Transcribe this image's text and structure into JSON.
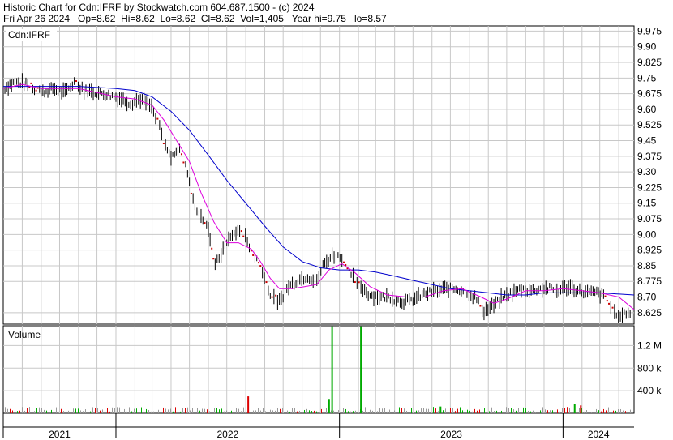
{
  "header": {
    "line1": "Historic Chart for Cdn:IFRF by Stockwatch.com 604.687.1500 - (c) 2024",
    "line2": "Fri Apr 26 2024   Op=8.62  Hi=8.62  Lo=8.62  Cl=8.62  Vol=1,405   Year hi=9.75   lo=8.57"
  },
  "colors": {
    "price_bar": "#000000",
    "down_dot": "#cc0000",
    "ma_short": "#dd00dd",
    "ma_long": "#0000cc",
    "volume_up": "#00aa00",
    "volume_down": "#dd0000",
    "volume_neutral": "#999999",
    "grid": "#c8c8c8"
  },
  "chart_data": {
    "type": "line",
    "symbol_label": "Cdn:IFRF",
    "volume_title": "Volume",
    "x_range": [
      "2021-07-01",
      "2024-04-26"
    ],
    "ylim": [
      8.57,
      10.0
    ],
    "price_ticks": [
      "9.975",
      "9.90",
      "9.825",
      "9.75",
      "9.675",
      "9.60",
      "9.525",
      "9.45",
      "9.375",
      "9.30",
      "9.225",
      "9.15",
      "9.075",
      "9.00",
      "8.925",
      "8.85",
      "8.775",
      "8.70",
      "8.625"
    ],
    "volume_ticks": [
      {
        "label": "1.2 M",
        "value": 1200000
      },
      {
        "label": "800 k",
        "value": 800000
      },
      {
        "label": "400 k",
        "value": 400000
      }
    ],
    "volume_ylim": [
      0,
      1550000
    ],
    "years": [
      {
        "label": "2021",
        "start": "2021-07-01",
        "end": "2022-01-01"
      },
      {
        "label": "2022",
        "start": "2022-01-01",
        "end": "2023-01-01"
      },
      {
        "label": "2023",
        "start": "2023-01-01",
        "end": "2024-01-01"
      },
      {
        "label": "2024",
        "start": "2024-01-01",
        "end": "2024-04-26"
      }
    ],
    "close": [
      [
        "2021-07-01",
        9.7
      ],
      [
        "2021-07-20",
        9.73
      ],
      [
        "2021-08-10",
        9.72
      ],
      [
        "2021-09-01",
        9.68
      ],
      [
        "2021-09-20",
        9.7
      ],
      [
        "2021-10-10",
        9.68
      ],
      [
        "2021-10-25",
        9.73
      ],
      [
        "2021-11-10",
        9.69
      ],
      [
        "2021-12-01",
        9.68
      ],
      [
        "2021-12-20",
        9.67
      ],
      [
        "2022-01-10",
        9.65
      ],
      [
        "2022-01-25",
        9.63
      ],
      [
        "2022-02-10",
        9.65
      ],
      [
        "2022-02-25",
        9.62
      ],
      [
        "2022-03-10",
        9.55
      ],
      [
        "2022-03-20",
        9.45
      ],
      [
        "2022-04-01",
        9.38
      ],
      [
        "2022-04-15",
        9.4
      ],
      [
        "2022-04-28",
        9.3
      ],
      [
        "2022-05-10",
        9.12
      ],
      [
        "2022-05-20",
        9.1
      ],
      [
        "2022-06-01",
        9.02
      ],
      [
        "2022-06-12",
        8.85
      ],
      [
        "2022-06-25",
        8.93
      ],
      [
        "2022-07-10",
        9.0
      ],
      [
        "2022-07-25",
        9.02
      ],
      [
        "2022-08-10",
        8.93
      ],
      [
        "2022-08-25",
        8.85
      ],
      [
        "2022-09-10",
        8.72
      ],
      [
        "2022-09-25",
        8.68
      ],
      [
        "2022-10-10",
        8.75
      ],
      [
        "2022-10-25",
        8.78
      ],
      [
        "2022-11-10",
        8.8
      ],
      [
        "2022-11-25",
        8.77
      ],
      [
        "2022-12-05",
        8.85
      ],
      [
        "2022-12-20",
        8.9
      ],
      [
        "2023-01-05",
        8.89
      ],
      [
        "2023-01-20",
        8.8
      ],
      [
        "2023-02-05",
        8.75
      ],
      [
        "2023-02-20",
        8.71
      ],
      [
        "2023-03-10",
        8.7
      ],
      [
        "2023-03-25",
        8.7
      ],
      [
        "2023-04-10",
        8.68
      ],
      [
        "2023-04-25",
        8.68
      ],
      [
        "2023-05-10",
        8.7
      ],
      [
        "2023-05-25",
        8.72
      ],
      [
        "2023-06-10",
        8.73
      ],
      [
        "2023-06-25",
        8.74
      ],
      [
        "2023-07-10",
        8.74
      ],
      [
        "2023-07-25",
        8.73
      ],
      [
        "2023-08-10",
        8.7
      ],
      [
        "2023-08-25",
        8.63
      ],
      [
        "2023-09-10",
        8.66
      ],
      [
        "2023-09-25",
        8.7
      ],
      [
        "2023-10-10",
        8.72
      ],
      [
        "2023-10-25",
        8.74
      ],
      [
        "2023-11-10",
        8.73
      ],
      [
        "2023-11-25",
        8.74
      ],
      [
        "2023-12-10",
        8.74
      ],
      [
        "2023-12-25",
        8.73
      ],
      [
        "2024-01-10",
        8.75
      ],
      [
        "2024-01-25",
        8.73
      ],
      [
        "2024-02-10",
        8.72
      ],
      [
        "2024-02-25",
        8.72
      ],
      [
        "2024-03-10",
        8.7
      ],
      [
        "2024-03-25",
        8.62
      ],
      [
        "2024-04-10",
        8.62
      ],
      [
        "2024-04-26",
        8.62
      ]
    ],
    "ma_short": [
      [
        "2021-07-01",
        9.7
      ],
      [
        "2021-08-01",
        9.72
      ],
      [
        "2021-09-01",
        9.7
      ],
      [
        "2021-10-01",
        9.7
      ],
      [
        "2021-11-01",
        9.7
      ],
      [
        "2021-12-01",
        9.68
      ],
      [
        "2022-01-01",
        9.66
      ],
      [
        "2022-02-01",
        9.65
      ],
      [
        "2022-03-01",
        9.62
      ],
      [
        "2022-03-20",
        9.55
      ],
      [
        "2022-04-10",
        9.45
      ],
      [
        "2022-05-01",
        9.35
      ],
      [
        "2022-05-20",
        9.2
      ],
      [
        "2022-06-10",
        9.06
      ],
      [
        "2022-07-01",
        8.96
      ],
      [
        "2022-07-20",
        8.96
      ],
      [
        "2022-08-10",
        8.93
      ],
      [
        "2022-08-25",
        8.87
      ],
      [
        "2022-09-10",
        8.79
      ],
      [
        "2022-09-25",
        8.74
      ],
      [
        "2022-10-15",
        8.74
      ],
      [
        "2022-11-05",
        8.75
      ],
      [
        "2022-11-25",
        8.76
      ],
      [
        "2022-12-15",
        8.83
      ],
      [
        "2023-01-05",
        8.86
      ],
      [
        "2023-01-25",
        8.82
      ],
      [
        "2023-02-20",
        8.75
      ],
      [
        "2023-03-20",
        8.71
      ],
      [
        "2023-04-20",
        8.7
      ],
      [
        "2023-05-20",
        8.7
      ],
      [
        "2023-06-20",
        8.73
      ],
      [
        "2023-07-20",
        8.74
      ],
      [
        "2023-08-20",
        8.7
      ],
      [
        "2023-09-10",
        8.67
      ],
      [
        "2023-10-01",
        8.69
      ],
      [
        "2023-11-01",
        8.73
      ],
      [
        "2023-12-01",
        8.73
      ],
      [
        "2024-01-01",
        8.74
      ],
      [
        "2024-02-01",
        8.73
      ],
      [
        "2024-03-01",
        8.72
      ],
      [
        "2024-04-01",
        8.7
      ],
      [
        "2024-04-26",
        8.64
      ]
    ],
    "ma_long": [
      [
        "2021-07-01",
        9.71
      ],
      [
        "2021-09-01",
        9.71
      ],
      [
        "2021-11-01",
        9.71
      ],
      [
        "2022-01-01",
        9.7
      ],
      [
        "2022-02-01",
        9.69
      ],
      [
        "2022-03-01",
        9.66
      ],
      [
        "2022-04-01",
        9.59
      ],
      [
        "2022-05-01",
        9.5
      ],
      [
        "2022-06-01",
        9.38
      ],
      [
        "2022-07-01",
        9.26
      ],
      [
        "2022-08-01",
        9.15
      ],
      [
        "2022-09-01",
        9.04
      ],
      [
        "2022-10-01",
        8.94
      ],
      [
        "2022-11-01",
        8.87
      ],
      [
        "2022-12-01",
        8.84
      ],
      [
        "2023-01-01",
        8.83
      ],
      [
        "2023-02-01",
        8.83
      ],
      [
        "2023-03-01",
        8.82
      ],
      [
        "2023-04-01",
        8.8
      ],
      [
        "2023-05-01",
        8.78
      ],
      [
        "2023-06-01",
        8.76
      ],
      [
        "2023-07-01",
        8.74
      ],
      [
        "2023-08-01",
        8.73
      ],
      [
        "2023-09-01",
        8.72
      ],
      [
        "2023-10-01",
        8.71
      ],
      [
        "2023-11-01",
        8.71
      ],
      [
        "2023-12-01",
        8.72
      ],
      [
        "2024-01-01",
        8.72
      ],
      [
        "2024-02-01",
        8.72
      ],
      [
        "2024-03-01",
        8.72
      ],
      [
        "2024-04-26",
        8.71
      ]
    ],
    "volume_spikes": [
      {
        "date": "2021-07-05",
        "value": 110000,
        "color": "neutral"
      },
      {
        "date": "2022-08-05",
        "value": 300000,
        "color": "down"
      },
      {
        "date": "2022-12-15",
        "value": 240000,
        "color": "up"
      },
      {
        "date": "2022-12-20",
        "value": 1540000,
        "color": "up"
      },
      {
        "date": "2023-02-05",
        "value": 1540000,
        "color": "up"
      },
      {
        "date": "2023-06-15",
        "value": 120000,
        "color": "up"
      },
      {
        "date": "2024-01-20",
        "value": 160000,
        "color": "up"
      },
      {
        "date": "2024-01-30",
        "value": 140000,
        "color": "down"
      }
    ]
  }
}
